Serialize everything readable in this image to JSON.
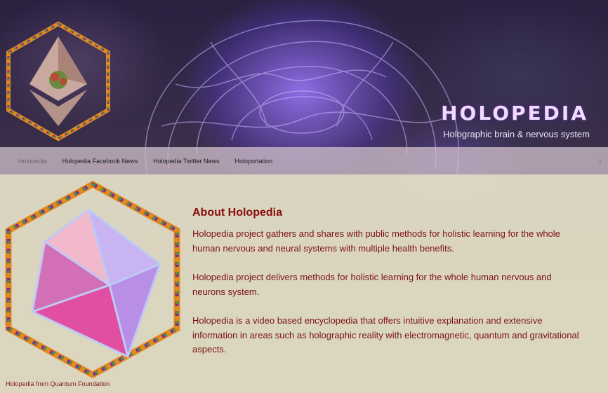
{
  "header": {
    "title": "HOLOPEDIA",
    "description": "Holographic brain & nervous system",
    "logo_icon": "ethereum-crystal-logo-icon"
  },
  "nav": {
    "items": [
      {
        "label": "Holopedia",
        "active": true
      },
      {
        "label": "Holopedia Facebook News"
      },
      {
        "label": "Holopedia Twitter News"
      },
      {
        "label": "Holoportation"
      }
    ],
    "scroll_icon": "arrow-down-icon"
  },
  "main": {
    "image_icon": "octahedron-crystal-icon",
    "caption": "Holopedia from Quantum Foundation",
    "heading": "About Holopedia",
    "paragraphs": [
      "Holopedia project gathers and shares with public methods for holistic learning for the whole human nervous and neural systems with multiple health benefits.",
      "Holopedia project delivers methods for holistic learning for the whole human nervous and neurons system.",
      "Holopedia is a video based encyclopedia that offers intuitive explanation and extensive information in areas such as holographic reality with electromagnetic, quantum and gravitational aspects."
    ]
  },
  "colors": {
    "title": "#f2d9ff",
    "text": "#7a1212",
    "heading": "#8a0c0c",
    "nav_bg": "#cdbcc8",
    "content_bg": "#f0ecd2"
  }
}
